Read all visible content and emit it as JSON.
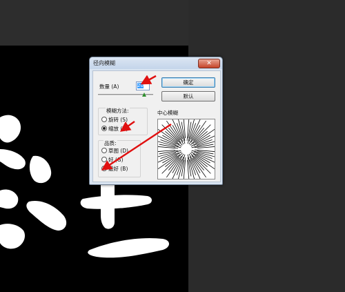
{
  "dialog": {
    "title": "径向模糊",
    "close_symbol": "✕",
    "amount_label": "数量 (A)",
    "amount_value": "20",
    "ok_label": "确定",
    "default_label": "默认",
    "blur_method_label": "模糊方法:",
    "blur_methods": [
      {
        "label": "旋转 (S)",
        "checked": false
      },
      {
        "label": "缩放 (Z)",
        "checked": true
      }
    ],
    "quality_label": "品质:",
    "qualities": [
      {
        "label": "草图 (D)",
        "checked": false
      },
      {
        "label": "好 (G)",
        "checked": false
      },
      {
        "label": "最好 (B)",
        "checked": true
      }
    ],
    "center_label": "中心模糊"
  },
  "colors": {
    "annotation_arrow": "#e01010",
    "background": "#2d2d2d",
    "canvas": "#000000"
  }
}
